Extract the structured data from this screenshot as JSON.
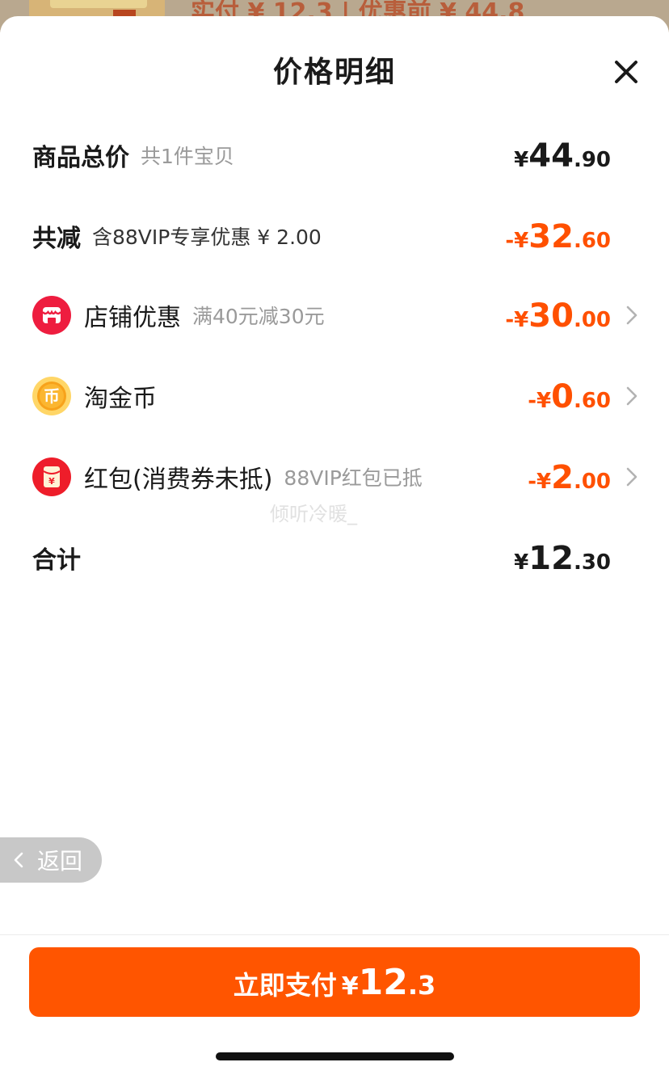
{
  "background": {
    "text": "实付 ¥ 12.3 | 优惠前 ¥ 44.8"
  },
  "sheet": {
    "title": "价格明细",
    "close_icon": "close-icon"
  },
  "rows": {
    "total": {
      "label": "商品总价",
      "sub": "共1件宝贝",
      "currency": "¥",
      "int": "44",
      "dec": ".90"
    },
    "reduction": {
      "label": "共减",
      "sub": "含88VIP专享优惠 ¥ 2.00",
      "currency": "-¥",
      "int": "32",
      "dec": ".60"
    },
    "shop": {
      "icon": "shop-icon",
      "label": "店铺优惠",
      "sub": "满40元减30元",
      "currency": "-¥",
      "int": "30",
      "dec": ".00"
    },
    "coins": {
      "icon": "coin-icon",
      "label": "淘金币",
      "sub": "",
      "currency": "-¥",
      "int": "0",
      "dec": ".60"
    },
    "redpacket": {
      "icon": "red-packet-icon",
      "label": "红包(消费券未抵)",
      "sub": "88VIP红包已抵",
      "currency": "-¥",
      "int": "2",
      "dec": ".00"
    },
    "sum": {
      "label": "合计",
      "currency": "¥",
      "int": "12",
      "dec": ".30"
    }
  },
  "watermark": "倾听冷暖_",
  "back_button": {
    "label": "返回"
  },
  "pay_button": {
    "label": "立即支付",
    "currency": "¥",
    "int": "12",
    "dec": ".3"
  },
  "colors": {
    "accent": "#ff5000",
    "button": "#ff5500",
    "text": "#1a1a1a",
    "muted": "#9a9a9a"
  }
}
